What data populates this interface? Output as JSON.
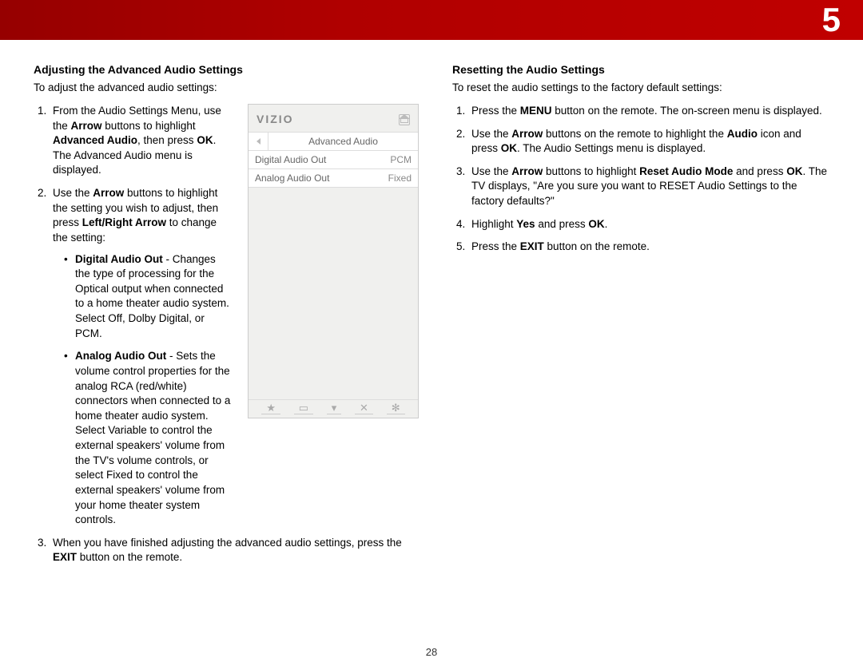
{
  "chapter": "5",
  "page_number": "28",
  "left": {
    "heading": "Adjusting the Advanced Audio Settings",
    "intro": "To adjust the advanced audio settings:",
    "step1_a": "From the Audio Settings Menu, use the ",
    "step1_b": "Arrow",
    "step1_c": " buttons to highlight ",
    "step1_d": "Advanced Audio",
    "step1_e": ", then press ",
    "step1_f": "OK",
    "step1_g": ". The Advanced Audio menu is displayed.",
    "step2_a": "Use the ",
    "step2_b": "Arrow",
    "step2_c": " buttons to highlight the setting you wish to adjust, then press ",
    "step2_d": "Left/Right Arrow",
    "step2_e": " to change the setting:",
    "bullets": {
      "b1_title": "Digital Audio Out",
      "b1_text": " - Changes the type of processing for the Optical output when connected to a home theater audio system. Select Off, Dolby Digital, or PCM.",
      "b2_title": "Analog Audio Out",
      "b2_text": " - Sets the volume control properties for the analog RCA (red/white) connectors when connected to a home theater audio system. Select Variable to control the external speakers' volume from the TV's volume controls, or select Fixed to control the external speakers' volume from your home theater system controls."
    },
    "step3_a": "When you have finished adjusting the advanced audio settings, press the ",
    "step3_b": "EXIT",
    "step3_c": " button on the remote."
  },
  "right": {
    "heading": "Resetting the Audio Settings",
    "intro": "To reset the audio settings to the factory default settings:",
    "s1_a": "Press the ",
    "s1_b": "MENU",
    "s1_c": " button on the remote. The on-screen menu is displayed.",
    "s2_a": "Use the ",
    "s2_b": "Arrow",
    "s2_c": " buttons on the remote to highlight the ",
    "s2_d": "Audio",
    "s2_e": " icon and press ",
    "s2_f": "OK",
    "s2_g": ". The Audio Settings menu is displayed.",
    "s3_a": "Use the ",
    "s3_b": "Arrow",
    "s3_c": " buttons to highlight ",
    "s3_d": "Reset Audio Mode",
    "s3_e": " and press ",
    "s3_f": "OK",
    "s3_g": ". The TV displays, \"Are you sure you want to RESET Audio Settings to the factory defaults?\"",
    "s4_a": "Highlight ",
    "s4_b": "Yes",
    "s4_c": " and press ",
    "s4_d": "OK",
    "s4_e": ".",
    "s5_a": "Press the ",
    "s5_b": "EXIT",
    "s5_c": " button on the remote."
  },
  "vizio": {
    "logo": "VIZIO",
    "title": "Advanced Audio",
    "row1_label": "Digital Audio Out",
    "row1_value": "PCM",
    "row2_label": "Analog Audio Out",
    "row2_value": "Fixed",
    "icons": {
      "star": "★",
      "wide": "▭",
      "v": "▾",
      "x": "✕",
      "gear": "✻"
    }
  }
}
